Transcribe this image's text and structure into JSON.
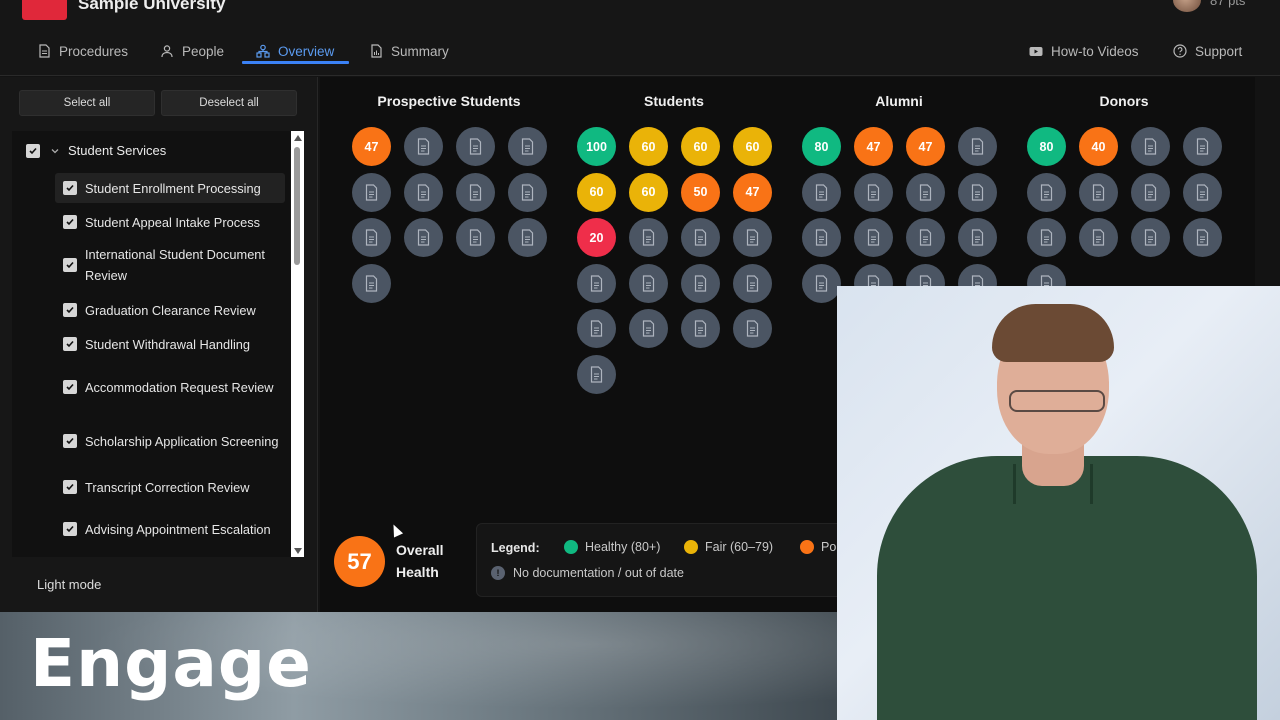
{
  "app": {
    "brand": "Sample University",
    "points": "87 pts"
  },
  "nav": {
    "left": [
      {
        "label": "Procedures",
        "icon": "document-icon"
      },
      {
        "label": "People",
        "icon": "people-icon"
      },
      {
        "label": "Overview",
        "icon": "org-chart-icon",
        "active": true
      },
      {
        "label": "Summary",
        "icon": "summary-icon"
      }
    ],
    "right": [
      {
        "label": "How-to Videos",
        "icon": "video-icon"
      },
      {
        "label": "Support",
        "icon": "help-icon"
      }
    ]
  },
  "sidebar": {
    "select_all": "Select all",
    "deselect_all": "Deselect all",
    "group": {
      "label": "Student Services",
      "checked": true,
      "expanded": true
    },
    "items": [
      {
        "label": "Student Enrollment Processing",
        "checked": true,
        "highlighted": true
      },
      {
        "label": "Student Appeal Intake Process",
        "checked": true
      },
      {
        "label": "International Student Document Review",
        "checked": true
      },
      {
        "label": "Graduation Clearance Review",
        "checked": true
      },
      {
        "label": "Student Withdrawal Handling",
        "checked": true
      },
      {
        "label": "Accommodation Request Review",
        "checked": true
      },
      {
        "label": "Scholarship Application Screening",
        "checked": true
      },
      {
        "label": "Transcript Correction Review",
        "checked": true
      },
      {
        "label": "Advising Appointment Escalation",
        "checked": true
      }
    ],
    "light_mode": "Light mode"
  },
  "columns": [
    {
      "title": "Prospective Students",
      "cells": [
        47,
        null,
        null,
        null,
        null,
        null,
        null,
        null,
        null,
        null,
        null,
        null,
        null
      ]
    },
    {
      "title": "Students",
      "cells": [
        100,
        60,
        60,
        60,
        60,
        60,
        50,
        47,
        20,
        null,
        null,
        null,
        null,
        null,
        null,
        null,
        null,
        null,
        null,
        null,
        null
      ]
    },
    {
      "title": "Alumni",
      "cells": [
        80,
        47,
        47,
        null,
        null,
        null,
        null,
        null,
        null,
        null,
        null,
        null,
        null,
        null,
        null,
        null
      ]
    },
    {
      "title": "Donors",
      "cells": [
        80,
        40,
        null,
        null,
        null,
        null,
        null,
        null,
        null,
        null,
        null,
        null,
        null
      ]
    }
  ],
  "status_colors": {
    "healthy": "#10b981",
    "fair": "#eab308",
    "poor": "#f97316",
    "critical": "#ef2e4a",
    "none": "#4b5563"
  },
  "overall": {
    "value": "57",
    "label": "Overall Health"
  },
  "legend": {
    "title": "Legend:",
    "items": [
      {
        "label": "Healthy (80+)",
        "color": "#10b981"
      },
      {
        "label": "Fair (60–79)",
        "color": "#eab308"
      },
      {
        "label": "Po",
        "color": "#f97316"
      }
    ],
    "no_doc": "No documentation / out of date"
  },
  "banner": {
    "text": "Engage"
  }
}
